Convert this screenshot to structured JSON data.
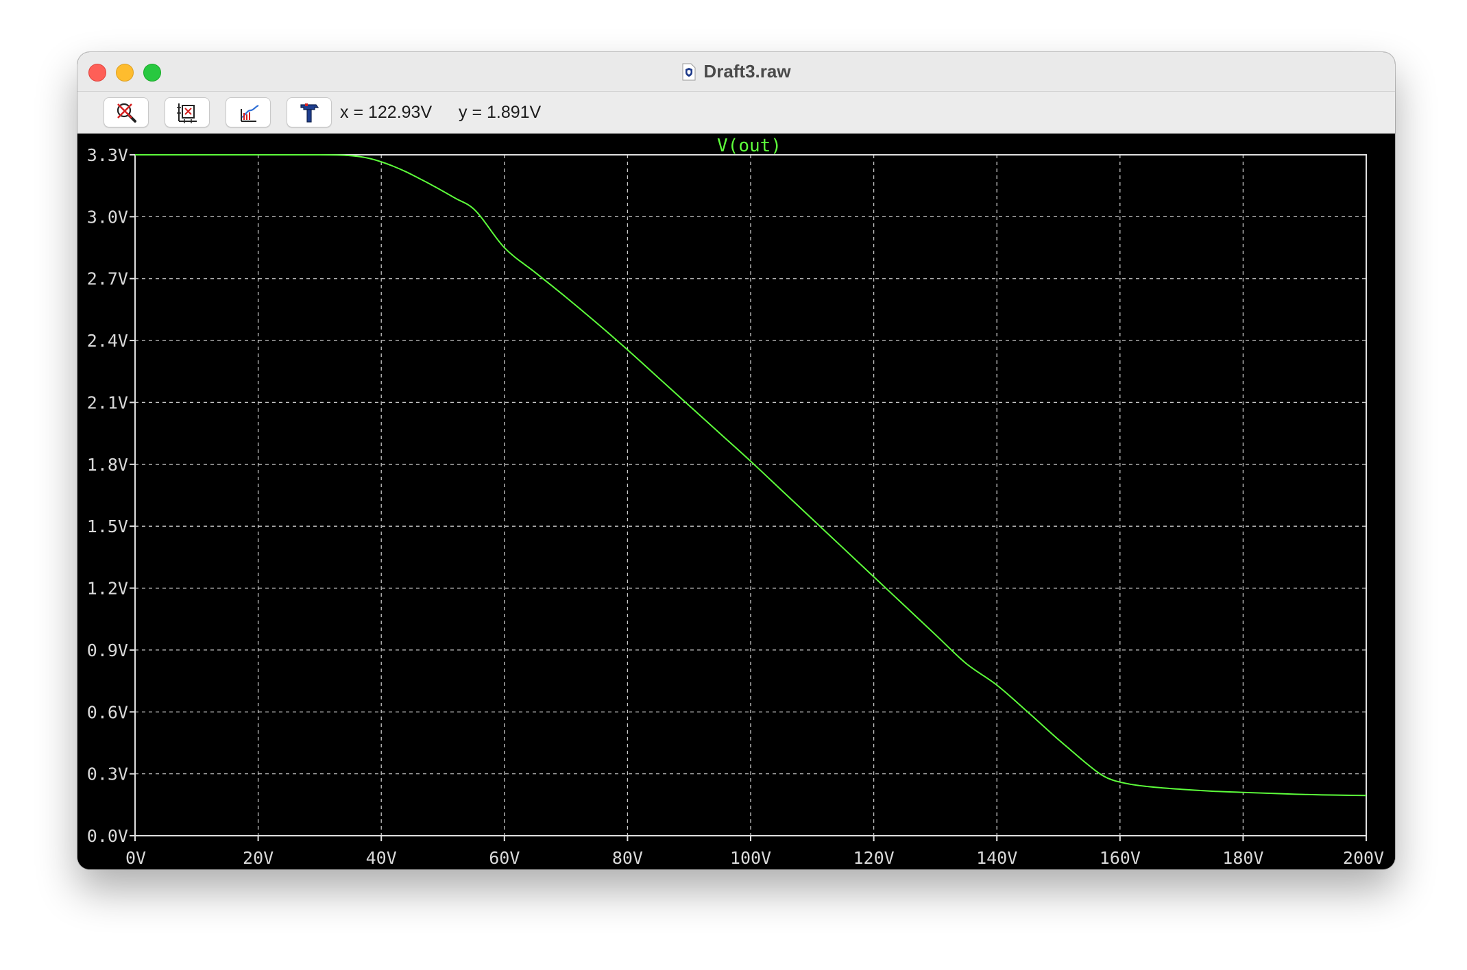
{
  "window": {
    "title": "Draft3.raw"
  },
  "toolbar": {
    "buttons": [
      {
        "name": "autorange-zoom-button",
        "icon": "zoom-cancel-icon"
      },
      {
        "name": "zoom-extents-button",
        "icon": "zoom-extents-icon"
      },
      {
        "name": "pan-button",
        "icon": "pan-axes-icon"
      },
      {
        "name": "settings-button",
        "icon": "hammer-icon"
      }
    ],
    "cursor_x": "x = 122.93V",
    "cursor_y": "y = 1.891V"
  },
  "colors": {
    "trace": "#5dff3b",
    "trace_label": "#5dff3b",
    "grid": "#c8c8c8",
    "axis": "#e0e0e0",
    "tick_text": "#d9d9d9",
    "background": "#000000"
  },
  "chart_data": {
    "type": "line",
    "title": "V(out)",
    "xlabel": "",
    "ylabel": "",
    "xlim": [
      0,
      200
    ],
    "ylim": [
      0,
      3.3
    ],
    "x_ticks": [
      0,
      20,
      40,
      60,
      80,
      100,
      120,
      140,
      160,
      180,
      200
    ],
    "x_tick_labels": [
      "0V",
      "20V",
      "40V",
      "60V",
      "80V",
      "100V",
      "120V",
      "140V",
      "160V",
      "180V",
      "200V"
    ],
    "y_ticks": [
      0.0,
      0.3,
      0.6,
      0.9,
      1.2,
      1.5,
      1.8,
      2.1,
      2.4,
      2.7,
      3.0,
      3.3
    ],
    "y_tick_labels": [
      "0.0V",
      "0.3V",
      "0.6V",
      "0.9V",
      "1.2V",
      "1.5V",
      "1.8V",
      "2.1V",
      "2.4V",
      "2.7V",
      "3.0V",
      "3.3V"
    ],
    "grid": true,
    "grid_style": "dashed",
    "legend": "top-center",
    "series": [
      {
        "name": "V(out)",
        "x": [
          0,
          10,
          20,
          30,
          34,
          36,
          38,
          40,
          42,
          44,
          46,
          48,
          50,
          52,
          55,
          60,
          65,
          70,
          75,
          80,
          85,
          90,
          95,
          100,
          105,
          110,
          115,
          120,
          125,
          130,
          135,
          140,
          145,
          150,
          152,
          154,
          156,
          157,
          158,
          159,
          160,
          162,
          165,
          170,
          175,
          180,
          185,
          190,
          195,
          200
        ],
        "values": [
          3.3,
          3.3,
          3.3,
          3.3,
          3.298,
          3.293,
          3.283,
          3.266,
          3.244,
          3.218,
          3.188,
          3.157,
          3.124,
          3.09,
          3.038,
          2.85,
          2.73,
          2.61,
          2.485,
          2.355,
          2.22,
          2.085,
          1.95,
          1.815,
          1.675,
          1.535,
          1.395,
          1.255,
          1.115,
          0.975,
          0.835,
          0.73,
          0.6,
          0.466,
          0.415,
          0.364,
          0.316,
          0.295,
          0.279,
          0.268,
          0.26,
          0.248,
          0.237,
          0.225,
          0.216,
          0.21,
          0.205,
          0.2,
          0.197,
          0.195
        ]
      }
    ]
  }
}
